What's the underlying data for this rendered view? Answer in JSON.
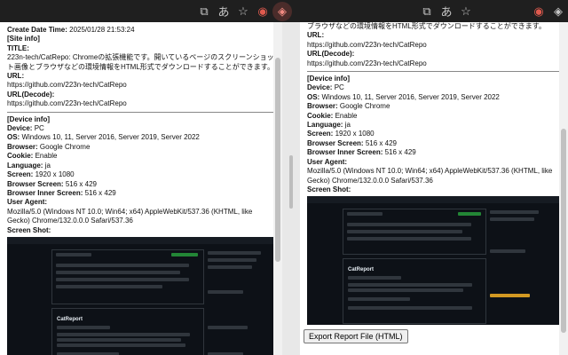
{
  "toolbar": {
    "icons": [
      "screen-capture-icon",
      "translate-icon",
      "bookmark-star-icon",
      "extension-icon",
      "catreport-icon"
    ]
  },
  "left": {
    "create_label": "Create Date Time:",
    "create_value": "2025/01/28 21:53:24",
    "site_info": "[Site info]",
    "title_label": "TITLE:",
    "title_value": "223n-tech/CatRepo: Chromeの拡張機能です。開いているページのスクリーンショット画像とブラウザなどの環境情報をHTML形式でダウンロードすることができます。",
    "url_label": "URL:",
    "url_value": "https://github.com/223n-tech/CatRepo",
    "url_decode_label": "URL(Decode):",
    "url_decode_value": "https://github.com/223n-tech/CatRepo",
    "device_info": "[Device info]",
    "device_label": "Device:",
    "device_value": "PC",
    "os_label": "OS:",
    "os_value": "Windows 10, 11, Server 2016, Server 2019, Server 2022",
    "browser_label": "Browser:",
    "browser_value": "Google Chrome",
    "cookie_label": "Cookie:",
    "cookie_value": "Enable",
    "language_label": "Language:",
    "language_value": "ja",
    "screen_label": "Screen:",
    "screen_value": "1920 x 1080",
    "browser_screen_label": "Browser Screen:",
    "browser_screen_value": "516 x 429",
    "browser_inner_label": "Browser Inner Screen:",
    "browser_inner_value": "516 x 429",
    "ua_label": "User Agent:",
    "ua_value": "Mozilla/5.0 (Windows NT 10.0; Win64; x64) AppleWebKit/537.36 (KHTML, like Gecko) Chrome/132.0.0.0 Safari/537.36",
    "screenshot_label": "Screen Shot:"
  },
  "right": {
    "title_tail": "ブラウザなどの環境情報をHTML形式でダウンロードすることができます。",
    "url_label": "URL:",
    "url_value": "https://github.com/223n-tech/CatRepo",
    "url_decode_label": "URL(Decode):",
    "url_decode_value": "https://github.com/223n-tech/CatRepo",
    "device_info": "[Device info]",
    "device_label": "Device:",
    "device_value": "PC",
    "os_label": "OS:",
    "os_value": "Windows 10, 11, Server 2016, Server 2019, Server 2022",
    "browser_label": "Browser:",
    "browser_value": "Google Chrome",
    "cookie_label": "Cookie:",
    "cookie_value": "Enable",
    "language_label": "Language:",
    "language_value": "ja",
    "screen_label": "Screen:",
    "screen_value": "1920 x 1080",
    "browser_screen_label": "Browser Screen:",
    "browser_screen_value": "516 x 429",
    "browser_inner_label": "Browser Inner Screen:",
    "browser_inner_value": "516 x 429",
    "ua_label": "User Agent:",
    "ua_value": "Mozilla/5.0 (Windows NT 10.0; Win64; x64) AppleWebKit/537.36 (KHTML, like Gecko) Chrome/132.0.0.0 Safari/537.36",
    "screenshot_label": "Screen Shot:",
    "export_button": "Export Report File (HTML)"
  },
  "screenshot": {
    "repo_title": "CatReport"
  }
}
